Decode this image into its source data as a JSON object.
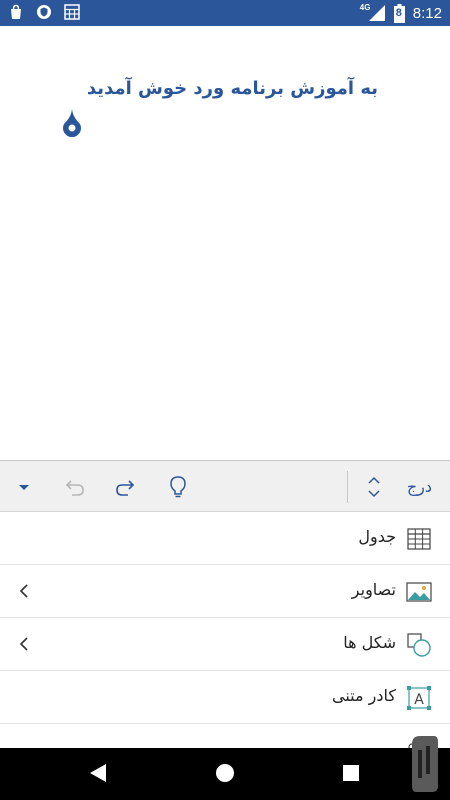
{
  "status_bar": {
    "time": "8:12",
    "network": "4G",
    "battery_level": "8",
    "icons": [
      "shopping-bag-icon",
      "shield-icon",
      "calculator-icon",
      "signal-icon",
      "battery-icon"
    ]
  },
  "document": {
    "body_text": "به آموزش برنامه ورد خوش آمدید"
  },
  "toolbar": {
    "tab_label": "درج",
    "icons": [
      "ribbon-collapse-icon",
      "undo-icon",
      "redo-icon",
      "lightbulb-icon",
      "tab-switch-icon"
    ]
  },
  "insert_menu": {
    "items": [
      {
        "label": "جدول",
        "icon": "table-icon",
        "has_submenu": false
      },
      {
        "label": "تصاویر",
        "icon": "pictures-icon",
        "has_submenu": true
      },
      {
        "label": "شکل ها",
        "icon": "shapes-icon",
        "has_submenu": true
      },
      {
        "label": "کادر متنی",
        "icon": "text-box-icon",
        "has_submenu": false
      }
    ]
  },
  "nav_bar": {
    "icons": [
      "back-icon",
      "home-icon",
      "recents-icon"
    ]
  },
  "colors": {
    "accent": "#2b579a",
    "toolbar_bg": "#f0f0f0",
    "icon_teal": "#3a9da0"
  }
}
